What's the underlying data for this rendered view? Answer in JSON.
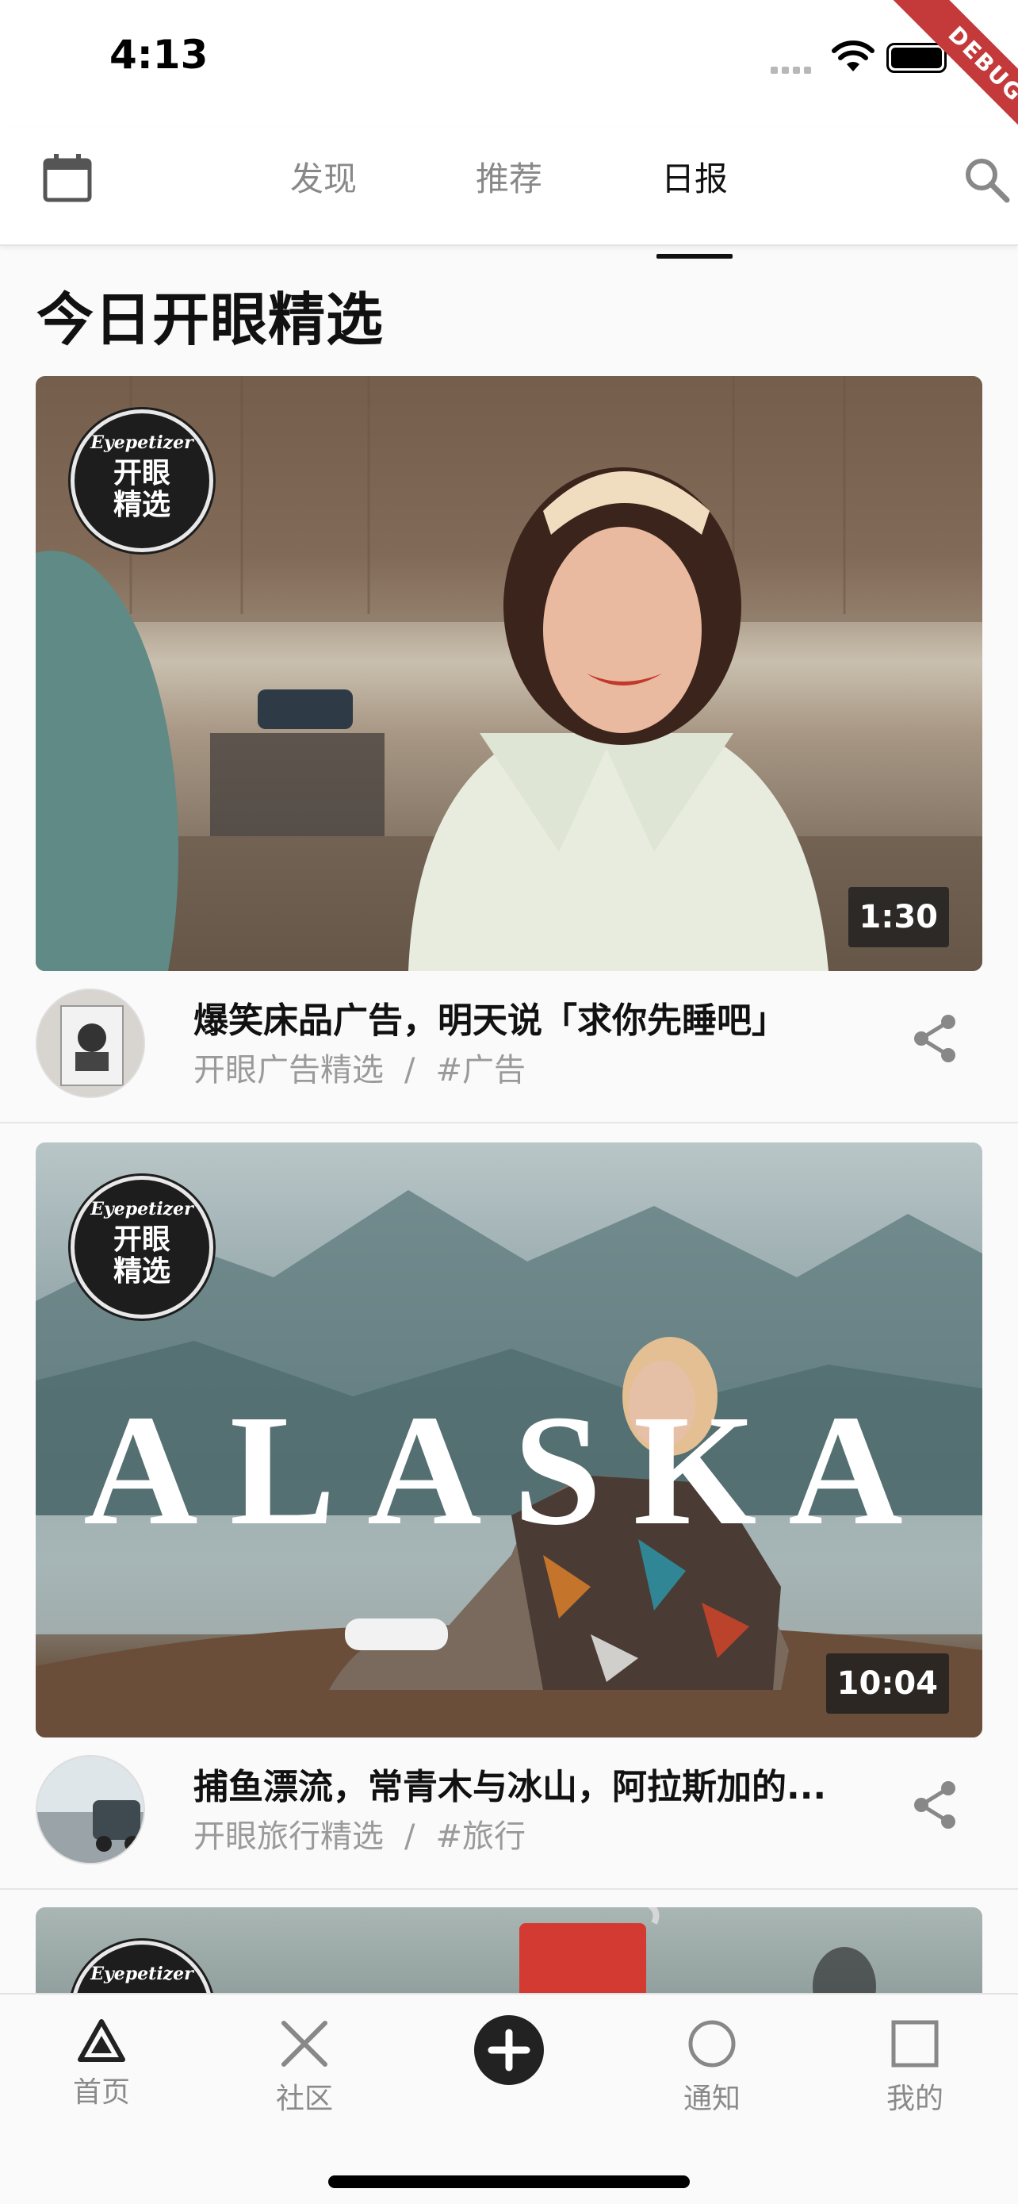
{
  "status_bar": {
    "time": "4:13",
    "debug_label": "DEBUG"
  },
  "top_nav": {
    "tabs": [
      {
        "label": "发现",
        "active": false
      },
      {
        "label": "推荐",
        "active": false
      },
      {
        "label": "日报",
        "active": true
      }
    ],
    "left_icon": "calendar-icon",
    "right_icon": "search-icon"
  },
  "section_title": "今日开眼精选",
  "badge": {
    "brand": "Eyepetizer",
    "line1": "开眼",
    "line2": "精选"
  },
  "cards": [
    {
      "title": "爆笑床品广告，明天说「求你先睡吧」",
      "category": "开眼广告精选",
      "separator": "/",
      "tag": "#广告",
      "duration": "1:30"
    },
    {
      "title": "捕鱼漂流，常青木与冰山，阿拉斯加的...",
      "category": "开眼旅行精选",
      "separator": "/",
      "tag": "#旅行",
      "duration": "10:04",
      "overlay_text": "ALASKA"
    }
  ],
  "bottom_nav": [
    {
      "label": "首页",
      "icon": "triangle-icon"
    },
    {
      "label": "社区",
      "icon": "cross-icon"
    },
    {
      "label": "",
      "icon": "plus-circle-icon"
    },
    {
      "label": "通知",
      "icon": "circle-icon"
    },
    {
      "label": "我的",
      "icon": "square-icon"
    }
  ],
  "colors": {
    "accent": "#111111",
    "muted": "#9a9a9a",
    "debug": "#c43a3a"
  }
}
